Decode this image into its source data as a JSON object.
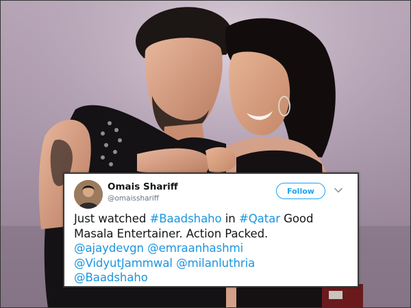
{
  "tweet": {
    "display_name": "Omais Shariff",
    "handle": "@omaisshariff",
    "follow_label": "Follow",
    "text_1": "Just watched ",
    "hashtag_1": "#Baadshaho",
    "text_2": " in ",
    "hashtag_2": "#Qatar",
    "text_3": " Good Masala Entertainer. Action Packed.",
    "mention_1": "@ajaydevgn",
    "mention_2": "@emraanhashmi",
    "mention_3": "@VidyutJammwal",
    "mention_4": "@milanluthria",
    "mention_5": "@Baadshaho"
  },
  "colors": {
    "link": "#1b95e0",
    "follow_accent": "#1da1f2",
    "handle_gray": "#657786",
    "backdrop": "#a895a9"
  },
  "icons": {
    "menu": "chevron-down-icon",
    "avatar": "avatar"
  }
}
